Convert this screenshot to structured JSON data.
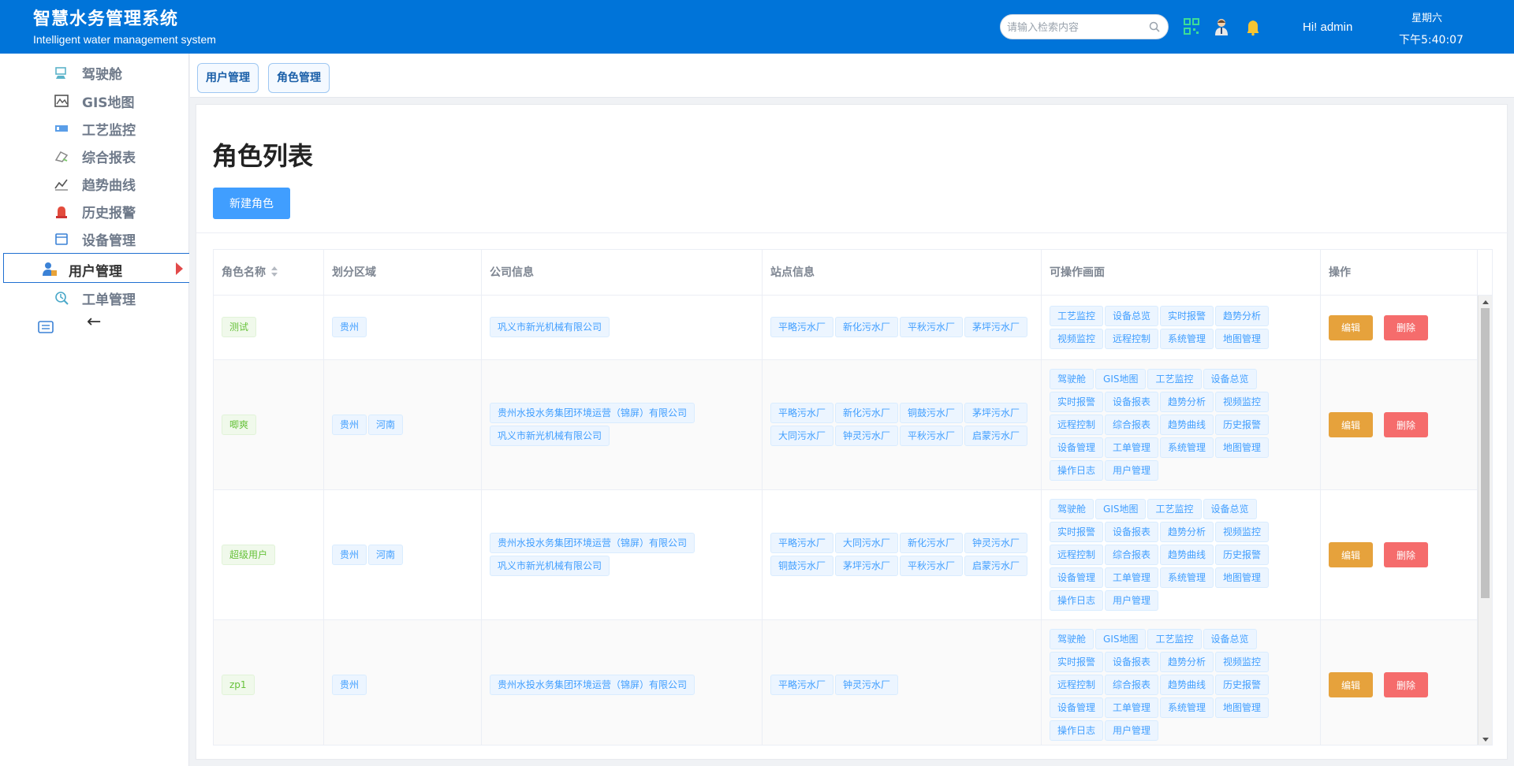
{
  "header": {
    "title": "智慧水务管理系统",
    "subtitle": "Intelligent water management system",
    "search_placeholder": "请输入检索内容",
    "greeting": "Hi!  admin",
    "weekday": "星期六",
    "time": "下午5:40:07",
    "colors": {
      "bar": "#0074d9"
    }
  },
  "sidebar": {
    "items": [
      {
        "label": "驾驶舱",
        "icon": "cockpit-icon"
      },
      {
        "label": "GIS地图",
        "icon": "map-icon"
      },
      {
        "label": "工艺监控",
        "icon": "process-monitor-icon"
      },
      {
        "label": "综合报表",
        "icon": "report-icon"
      },
      {
        "label": "趋势曲线",
        "icon": "trend-icon"
      },
      {
        "label": "历史报警",
        "icon": "alarm-icon"
      },
      {
        "label": "设备管理",
        "icon": "device-icon"
      },
      {
        "label": "用户管理",
        "icon": "user-icon",
        "active": true
      },
      {
        "label": "工单管理",
        "icon": "workorder-icon"
      }
    ],
    "collapse_label": "←"
  },
  "tabs": [
    {
      "label": "用户管理"
    },
    {
      "label": "角色管理"
    }
  ],
  "page": {
    "title": "角色列表",
    "new_button": "新建角色"
  },
  "table": {
    "columns": [
      "角色名称",
      "划分区域",
      "公司信息",
      "站点信息",
      "可操作画面",
      "操作"
    ],
    "edit_label": "编辑",
    "delete_label": "删除",
    "rows": [
      {
        "name": "测试",
        "regions": [
          "贵州"
        ],
        "companies": [
          "巩义市新光机械有限公司"
        ],
        "sites": [
          "平略污水厂",
          "新化污水厂",
          "平秋污水厂",
          "茅坪污水厂"
        ],
        "screens": [
          "工艺监控",
          "设备总览",
          "实时报警",
          "趋势分析",
          "视频监控",
          "远程控制",
          "系统管理",
          "地图管理"
        ]
      },
      {
        "name": "唧爽",
        "regions": [
          "贵州",
          "河南"
        ],
        "companies": [
          "贵州水投水务集团环境运营（锦屏）有限公司",
          "巩义市新光机械有限公司"
        ],
        "sites": [
          "平略污水厂",
          "新化污水厂",
          "铜鼓污水厂",
          "茅坪污水厂",
          "大同污水厂",
          "钟灵污水厂",
          "平秋污水厂",
          "启蒙污水厂"
        ],
        "screens": [
          "驾驶舱",
          "GIS地图",
          "工艺监控",
          "设备总览",
          "实时报警",
          "设备报表",
          "趋势分析",
          "视频监控",
          "远程控制",
          "综合报表",
          "趋势曲线",
          "历史报警",
          "设备管理",
          "工单管理",
          "系统管理",
          "地图管理",
          "操作日志",
          "用户管理"
        ]
      },
      {
        "name": "超级用户",
        "regions": [
          "贵州",
          "河南"
        ],
        "companies": [
          "贵州水投水务集团环境运营（锦屏）有限公司",
          "巩义市新光机械有限公司"
        ],
        "sites": [
          "平略污水厂",
          "大同污水厂",
          "新化污水厂",
          "钟灵污水厂",
          "铜鼓污水厂",
          "茅坪污水厂",
          "平秋污水厂",
          "启蒙污水厂"
        ],
        "screens": [
          "驾驶舱",
          "GIS地图",
          "工艺监控",
          "设备总览",
          "实时报警",
          "设备报表",
          "趋势分析",
          "视频监控",
          "远程控制",
          "综合报表",
          "趋势曲线",
          "历史报警",
          "设备管理",
          "工单管理",
          "系统管理",
          "地图管理",
          "操作日志",
          "用户管理"
        ]
      },
      {
        "name": "zp1",
        "regions": [
          "贵州"
        ],
        "companies": [
          "贵州水投水务集团环境运营（锦屏）有限公司"
        ],
        "sites": [
          "平略污水厂",
          "钟灵污水厂"
        ],
        "screens": [
          "驾驶舱",
          "GIS地图",
          "工艺监控",
          "设备总览",
          "实时报警",
          "设备报表",
          "趋势分析",
          "视频监控",
          "远程控制",
          "综合报表",
          "趋势曲线",
          "历史报警",
          "设备管理",
          "工单管理",
          "系统管理",
          "地图管理",
          "操作日志",
          "用户管理"
        ]
      }
    ]
  },
  "colors": {
    "accent": "#409eff",
    "edit": "#e6a23c",
    "delete": "#f56c6c",
    "tag_green": "#67c23a"
  }
}
